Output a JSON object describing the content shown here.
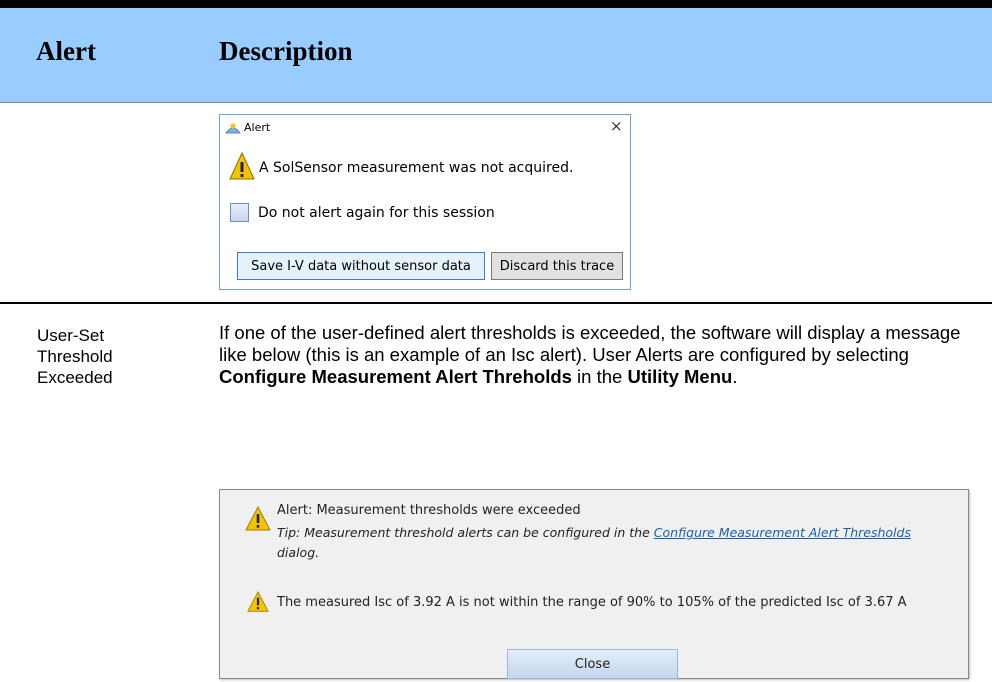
{
  "table": {
    "header": {
      "col1": "Alert",
      "col2": "Description"
    }
  },
  "dialog_sensor": {
    "title": "Alert",
    "close_glyph": "×",
    "message": "A SolSensor measurement was not acquired.",
    "checkbox_label": "Do not alert again for this session",
    "checkbox_checked": false,
    "buttons": {
      "save": "Save I-V data without sensor data",
      "discard": "Discard this trace"
    },
    "icons": [
      "app-sun-icon",
      "warning-icon"
    ]
  },
  "row_threshold": {
    "alert_name": "User-Set Threshold Exceeded",
    "description": {
      "part1": "If one of the user-defined alert thresholds is exceeded, the software will display a message like below (this is an example of an Isc alert).  User Alerts are configured by selecting ",
      "bold1": "Configure Measurement Alert Threholds",
      "part2": " in the ",
      "bold2": "Utility Menu",
      "part3": "."
    }
  },
  "dialog_threshold": {
    "title": "Alert: Measurement thresholds were exceeded",
    "tip_prefix": "Tip: Measurement threshold alerts can be configured in the ",
    "tip_link": "Configure Measurement Alert Thresholds",
    "tip_suffix": " dialog.",
    "message": "The measured Isc of 3.92 A is not within the range of 90% to 105% of the predicted Isc of 3.67 A",
    "close_label": "Close",
    "icons": [
      "warning-icon",
      "warning-icon"
    ]
  },
  "colors": {
    "header_bg": "#99ccff",
    "link": "#1a5fb4",
    "warning_yellow": "#f5c400"
  }
}
